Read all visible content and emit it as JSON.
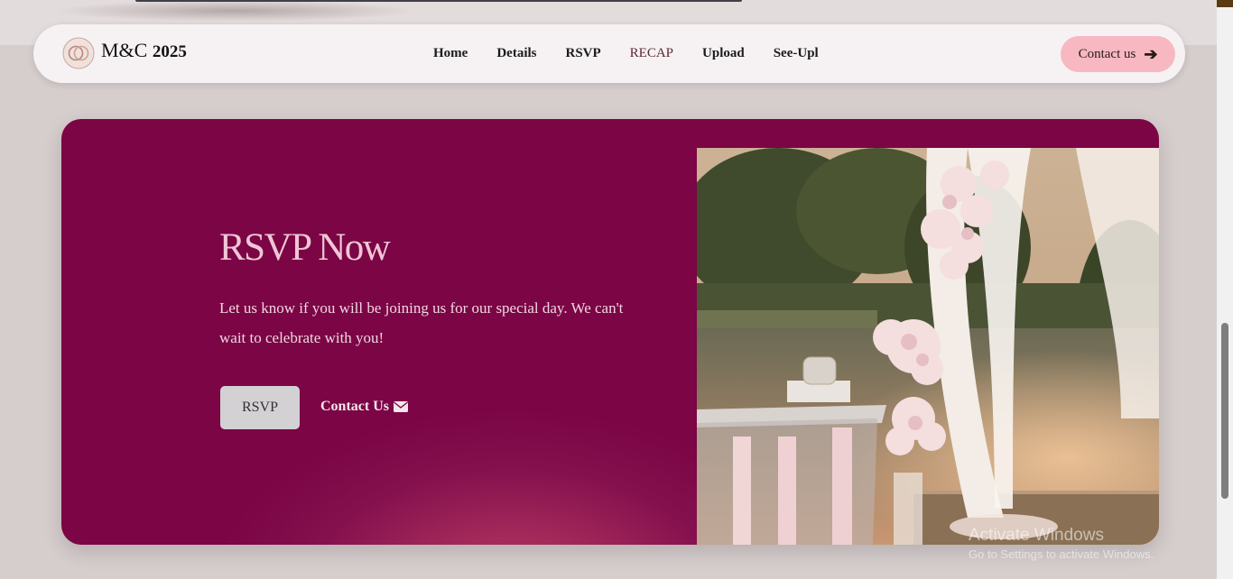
{
  "brand": {
    "name": "M&C",
    "year": "2025"
  },
  "nav": {
    "items": [
      {
        "label": "Home"
      },
      {
        "label": "Details"
      },
      {
        "label": "RSVP"
      },
      {
        "label": "RECAP"
      },
      {
        "label": "Upload"
      },
      {
        "label": "See-Upl"
      }
    ],
    "contact_label": "Contact us"
  },
  "hero": {
    "title": "RSVP Now",
    "text": "Let us know if you will be joining us for our special day. We can't wait to celebrate with you!",
    "rsvp_button": "RSVP",
    "contact_link": "Contact Us"
  },
  "watermark": {
    "line1": "Activate Windows",
    "line2": "Go to Settings to activate Windows."
  },
  "colors": {
    "hero_bg": "#7b0545",
    "accent_pink": "#f7b8c2",
    "title_pink": "#efc6d6"
  },
  "icons": [
    "logo-rings-icon",
    "arrow-right-icon",
    "envelope-icon"
  ]
}
